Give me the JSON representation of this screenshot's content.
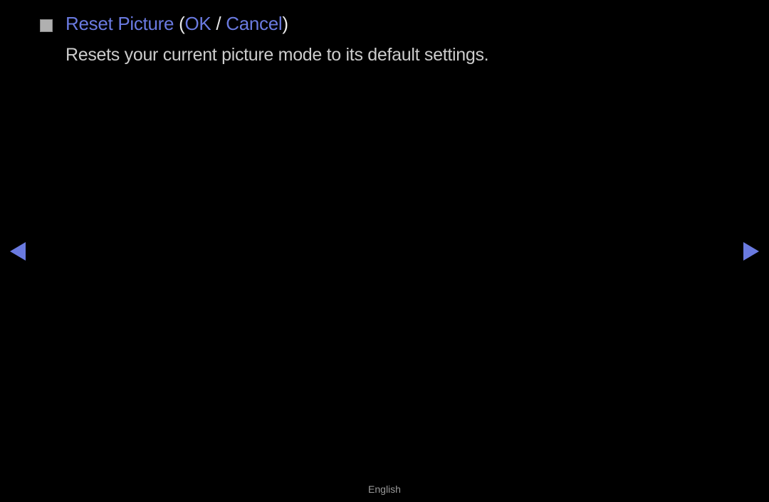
{
  "item": {
    "title": "Reset Picture",
    "paren_open": " (",
    "option_ok": "OK",
    "separator": " / ",
    "option_cancel": "Cancel",
    "paren_close": ")",
    "description": "Resets your current picture mode to its default settings."
  },
  "footer": {
    "language": "English"
  }
}
